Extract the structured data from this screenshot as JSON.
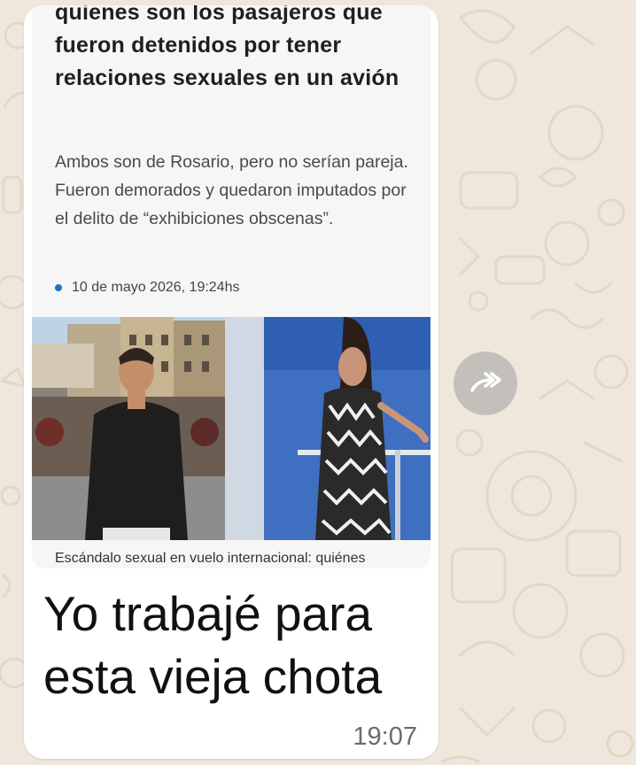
{
  "article": {
    "headline": "quienes son los pasajeros que fueron detenidos por tener relaciones sexuales en un avión",
    "summary": "Ambos son de Rosario, pero no serían pareja. Fueron demorados y quedaron imputados por el delito de “exhibiciones obscenas”.",
    "date": "10 de mayo 2026, 19:24hs",
    "caption": "Escándalo sexual en vuelo internacional: quiénes"
  },
  "message": {
    "line1": "Yo trabajé para",
    "line2": "esta vieja chota",
    "time": "19:07"
  },
  "icons": {
    "forward": "forward-arrow-icon"
  },
  "colors": {
    "wallpaper": "#efe7dc",
    "bubble": "#ffffff",
    "card": "#f6f6f6",
    "date_dot": "#1a73c8",
    "forward_button": "#c3c0bb"
  }
}
